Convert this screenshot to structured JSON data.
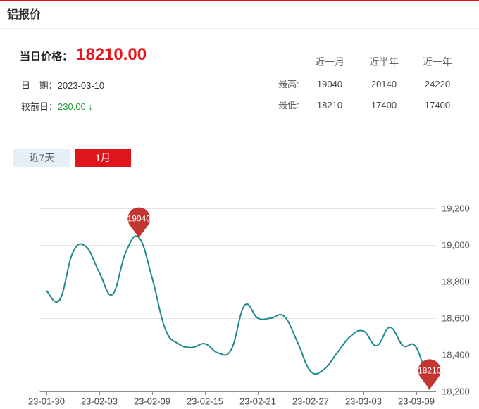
{
  "header": {
    "title": "铝报价"
  },
  "today": {
    "price_label": "当日价格：",
    "price": "18210.00",
    "date_label": "日 期：",
    "date": "2023-03-10",
    "change_label": "较前日：",
    "change": "230.00",
    "change_arrow": "↓"
  },
  "stats": {
    "columns": [
      "近一月",
      "近半年",
      "近一年"
    ],
    "rows": [
      {
        "label": "最高:",
        "values": [
          "19040",
          "20140",
          "24220"
        ]
      },
      {
        "label": "最低:",
        "values": [
          "18210",
          "17400",
          "17400"
        ]
      }
    ]
  },
  "tabs": [
    {
      "label": "近7天",
      "active": false
    },
    {
      "label": "1月",
      "active": true
    }
  ],
  "colors": {
    "brand_red": "#e0141b",
    "price_red": "#e8141c",
    "down_green": "#22a033",
    "tab_inactive_bg": "#e6eef8",
    "line": "#23898b",
    "marker": "#c23531"
  },
  "chart_data": {
    "type": "line",
    "smooth": true,
    "grid": true,
    "y_axis_position": "right",
    "x": [
      "23-01-30",
      "23-01-31",
      "23-02-01",
      "23-02-02",
      "23-02-03",
      "23-02-06",
      "23-02-07",
      "23-02-08",
      "23-02-09",
      "23-02-10",
      "23-02-13",
      "23-02-14",
      "23-02-15",
      "23-02-16",
      "23-02-17",
      "23-02-20",
      "23-02-21",
      "23-02-22",
      "23-02-23",
      "23-02-24",
      "23-02-27",
      "23-02-28",
      "23-03-01",
      "23-03-02",
      "23-03-03",
      "23-03-06",
      "23-03-07",
      "23-03-08",
      "23-03-09",
      "23-03-10"
    ],
    "values": [
      18750,
      18700,
      18960,
      18990,
      18850,
      18730,
      18960,
      19040,
      18820,
      18540,
      18460,
      18440,
      18460,
      18410,
      18430,
      18670,
      18600,
      18600,
      18610,
      18470,
      18310,
      18320,
      18410,
      18500,
      18530,
      18450,
      18550,
      18450,
      18440,
      18210
    ],
    "x_tick_labels": [
      "23-01-30",
      "23-02-03",
      "23-02-09",
      "23-02-15",
      "23-02-21",
      "23-02-27",
      "23-03-03",
      "23-03-09"
    ],
    "ylim": [
      18200,
      19200
    ],
    "y_tick_labels": [
      "18,200",
      "18,400",
      "18,600",
      "18,800",
      "19,000",
      "19,200"
    ],
    "mark_points": [
      {
        "kind": "max",
        "label": "19040"
      },
      {
        "kind": "min",
        "label": "18210"
      }
    ]
  }
}
